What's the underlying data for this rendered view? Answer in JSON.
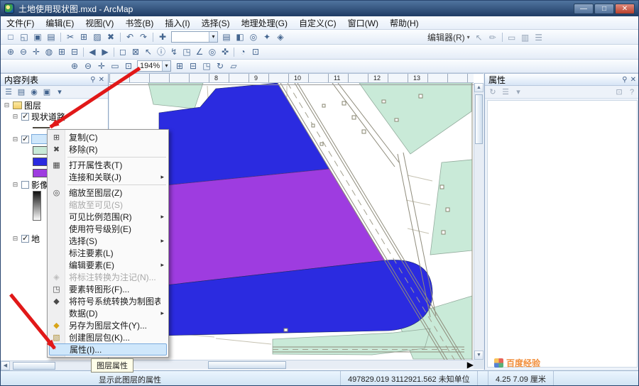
{
  "window": {
    "title": "土地使用现状图.mxd - ArcMap"
  },
  "glyphs": {
    "pin": "⚲",
    "close": "✕",
    "collapse": "⊟",
    "expand": "⊞",
    "submenu_arrow": "▸",
    "dropdown_arrow": "▾",
    "minimize": "—",
    "maximize": "□",
    "window_close": "✕",
    "scroll_up": "▲",
    "scroll_down": "▼",
    "scroll_left": "◀",
    "scroll_right": "▶"
  },
  "menu_bar": [
    {
      "name": "menu-file",
      "label": "文件(F)"
    },
    {
      "name": "menu-edit",
      "label": "编辑(E)"
    },
    {
      "name": "menu-view",
      "label": "视图(V)"
    },
    {
      "name": "menu-bookmarks",
      "label": "书签(B)"
    },
    {
      "name": "menu-insert",
      "label": "插入(I)"
    },
    {
      "name": "menu-selection",
      "label": "选择(S)"
    },
    {
      "name": "menu-geoprocessing",
      "label": "地理处理(G)"
    },
    {
      "name": "menu-customize",
      "label": "自定义(C)"
    },
    {
      "name": "menu-windows",
      "label": "窗口(W)"
    },
    {
      "name": "menu-help",
      "label": "帮助(H)"
    }
  ],
  "toolbars": {
    "scale_value": "",
    "zoom_value": "194%",
    "editor_label": "编辑器(R)",
    "standard": [
      {
        "name": "new-document-icon",
        "glyph": "□"
      },
      {
        "name": "open-icon",
        "glyph": "◱"
      },
      {
        "name": "save-icon",
        "glyph": "▣"
      },
      {
        "name": "print-icon",
        "glyph": "▤"
      },
      {
        "name": "toolbar-separator",
        "sep": true
      },
      {
        "name": "cut-icon",
        "glyph": "✂"
      },
      {
        "name": "copy-icon",
        "glyph": "⊞"
      },
      {
        "name": "paste-icon",
        "glyph": "▨"
      },
      {
        "name": "delete-icon",
        "glyph": "✖"
      },
      {
        "name": "toolbar-separator",
        "sep": true
      },
      {
        "name": "undo-icon",
        "glyph": "↶"
      },
      {
        "name": "redo-icon",
        "glyph": "↷"
      },
      {
        "name": "toolbar-separator",
        "sep": true
      },
      {
        "name": "add-data-icon",
        "glyph": "✚"
      }
    ],
    "standard_right": [
      {
        "name": "table-of-contents-icon",
        "glyph": "▤"
      },
      {
        "name": "catalog-icon",
        "glyph": "◧"
      },
      {
        "name": "search-icon",
        "glyph": "◎"
      },
      {
        "name": "toolbox-icon",
        "glyph": "✦"
      },
      {
        "name": "model-builder-icon",
        "glyph": "◈"
      }
    ],
    "editor_icons": [
      {
        "name": "edit-tool-icon",
        "glyph": "↖"
      },
      {
        "name": "sketch-tool-icon",
        "glyph": "✏"
      },
      {
        "name": "toolbar-separator",
        "sep": true
      },
      {
        "name": "create-features-icon",
        "glyph": "▭"
      },
      {
        "name": "attributes-icon",
        "glyph": "▥"
      },
      {
        "name": "sketch-menu-icon",
        "glyph": "☰"
      }
    ],
    "tools": [
      {
        "name": "zoom-in-icon",
        "glyph": "⊕"
      },
      {
        "name": "zoom-out-icon",
        "glyph": "⊖"
      },
      {
        "name": "pan-icon",
        "glyph": "✛"
      },
      {
        "name": "full-extent-icon",
        "glyph": "◍"
      },
      {
        "name": "fixed-zoom-in-icon",
        "glyph": "⊞"
      },
      {
        "name": "fixed-zoom-out-icon",
        "glyph": "⊟"
      },
      {
        "name": "toolbar-separator",
        "sep": true
      },
      {
        "name": "back-extent-icon",
        "glyph": "◀"
      },
      {
        "name": "forward-extent-icon",
        "glyph": "▶"
      },
      {
        "name": "toolbar-separator",
        "sep": true
      },
      {
        "name": "select-features-icon",
        "glyph": "◻"
      },
      {
        "name": "clear-selection-icon",
        "glyph": "⊠"
      },
      {
        "name": "select-elements-icon",
        "glyph": "↖"
      },
      {
        "name": "identify-icon",
        "glyph": "ⓘ"
      },
      {
        "name": "hyperlink-icon",
        "glyph": "↯"
      },
      {
        "name": "html-popup-icon",
        "glyph": "◳"
      },
      {
        "name": "measure-icon",
        "glyph": "∠"
      },
      {
        "name": "find-icon",
        "glyph": "◎"
      },
      {
        "name": "go-to-xy-icon",
        "glyph": "✜"
      },
      {
        "name": "toolbar-separator",
        "sep": true
      },
      {
        "name": "time-slider-icon",
        "glyph": "◔"
      },
      {
        "name": "viewer-window-icon",
        "glyph": "⊡"
      }
    ],
    "layout": [
      {
        "name": "layout-zoom-in-icon",
        "glyph": "⊕"
      },
      {
        "name": "layout-zoom-out-icon",
        "glyph": "⊖"
      },
      {
        "name": "layout-pan-icon",
        "glyph": "✛"
      },
      {
        "name": "layout-zoom-whole-page-icon",
        "glyph": "▭"
      },
      {
        "name": "layout-zoom-100-icon",
        "glyph": "⊡"
      }
    ],
    "layout_right": [
      {
        "name": "layout-fixed-zoom-in-icon",
        "glyph": "⊞"
      },
      {
        "name": "layout-fixed-zoom-out-icon",
        "glyph": "⊟"
      },
      {
        "name": "layout-focus-data-frame-icon",
        "glyph": "◳"
      },
      {
        "name": "layout-refresh-icon",
        "glyph": "↻"
      },
      {
        "name": "layout-toggle-draft-icon",
        "glyph": "▱"
      }
    ]
  },
  "toc": {
    "title": "内容列表",
    "toolbar_icons": [
      {
        "name": "list-by-drawing-order-icon",
        "glyph": "☰"
      },
      {
        "name": "list-by-source-icon",
        "glyph": "▤"
      },
      {
        "name": "list-by-visibility-icon",
        "glyph": "◉"
      },
      {
        "name": "list-by-selection-icon",
        "glyph": "▣"
      },
      {
        "name": "toc-options-icon",
        "glyph": "▾"
      }
    ],
    "group_label": "图层",
    "layer_roads": "现状道路",
    "layer_selected": "",
    "layer_image": "影像",
    "layer_bottom": "地"
  },
  "context_menu": {
    "items": [
      {
        "name": "menu-item-copy",
        "label": "复制(C)",
        "icon_name": "copy-icon",
        "icon_glyph": "⊞"
      },
      {
        "name": "menu-item-remove",
        "label": "移除(R)",
        "icon_name": "remove-icon",
        "icon_glyph": "✖"
      },
      {
        "name": "menu-separator",
        "sep": true
      },
      {
        "name": "menu-item-open-attribute-table",
        "label": "打开属性表(T)",
        "icon_name": "attribute-table-icon",
        "icon_glyph": "▦"
      },
      {
        "name": "menu-item-joins-and-relates",
        "label": "连接和关联(J)",
        "submenu": true
      },
      {
        "name": "menu-separator",
        "sep": true
      },
      {
        "name": "menu-item-zoom-to-layer",
        "label": "缩放至图层(Z)",
        "icon_name": "zoom-to-layer-icon",
        "icon_glyph": "◎"
      },
      {
        "name": "menu-item-zoom-to-make-visible",
        "label": "缩放至可见(S)",
        "disabled": true
      },
      {
        "name": "menu-item-visible-scale-range",
        "label": "可见比例范围(R)",
        "submenu": true
      },
      {
        "name": "menu-item-use-symbol-levels",
        "label": "使用符号级别(E)"
      },
      {
        "name": "menu-item-selection",
        "label": "选择(S)",
        "submenu": true
      },
      {
        "name": "menu-item-label-features",
        "label": "标注要素(L)"
      },
      {
        "name": "menu-item-edit-features",
        "label": "编辑要素(E)",
        "submenu": true
      },
      {
        "name": "menu-item-convert-labels-to-annotation",
        "label": "将标注转换为注记(N)...",
        "disabled": true,
        "icon_name": "convert-labels-icon",
        "icon_glyph": "◈"
      },
      {
        "name": "menu-item-features-to-graphics",
        "label": "要素转图形(F)...",
        "icon_name": "features-to-graphics-icon",
        "icon_glyph": "◳"
      },
      {
        "name": "menu-item-convert-symbology-to-representation",
        "label": "将符号系统转换为制图表达(B)...",
        "icon_name": "convert-symbology-icon",
        "icon_glyph": "◆"
      },
      {
        "name": "menu-item-data",
        "label": "数据(D)",
        "submenu": true
      },
      {
        "name": "menu-item-save-as-layer-file",
        "label": "另存为图层文件(Y)...",
        "icon_name": "save-layer-file-icon",
        "icon_glyph": "◆"
      },
      {
        "name": "menu-item-create-layer-package",
        "label": "创建图层包(K)...",
        "icon_name": "create-layer-package-icon",
        "icon_glyph": "▧"
      },
      {
        "name": "menu-item-properties",
        "label": "属性(I)...",
        "highlighted": true
      }
    ]
  },
  "map": {
    "ruler_numbers": [
      "8",
      "9",
      "10",
      "11",
      "12",
      "13"
    ]
  },
  "right_panel": {
    "title": "属性",
    "icons": [
      {
        "name": "rp-refresh-icon",
        "glyph": "↻"
      },
      {
        "name": "rp-list-icon",
        "glyph": "☰"
      },
      {
        "name": "rp-options-icon",
        "glyph": "▾"
      }
    ],
    "right_icons": [
      {
        "name": "rp-dock-icon",
        "glyph": "⊡"
      },
      {
        "name": "rp-help-icon",
        "glyph": "?"
      }
    ]
  },
  "status_bar": {
    "help": "显示此图层的属性",
    "coordinates": "497829.019 3112921.562 未知单位",
    "position": "4.25 7.09 厘米"
  },
  "tooltip": {
    "text": "图层属性"
  },
  "watermark": {
    "text": "百度经验"
  },
  "colors": {
    "parcel_blue": "#2b2be0",
    "parcel_purple": "#9e3ce0",
    "parcel_green": "#c9ead8",
    "arrow_red": "#e11818",
    "selection_fill": "#cfe7fb",
    "selection_border": "#7aabdd"
  }
}
